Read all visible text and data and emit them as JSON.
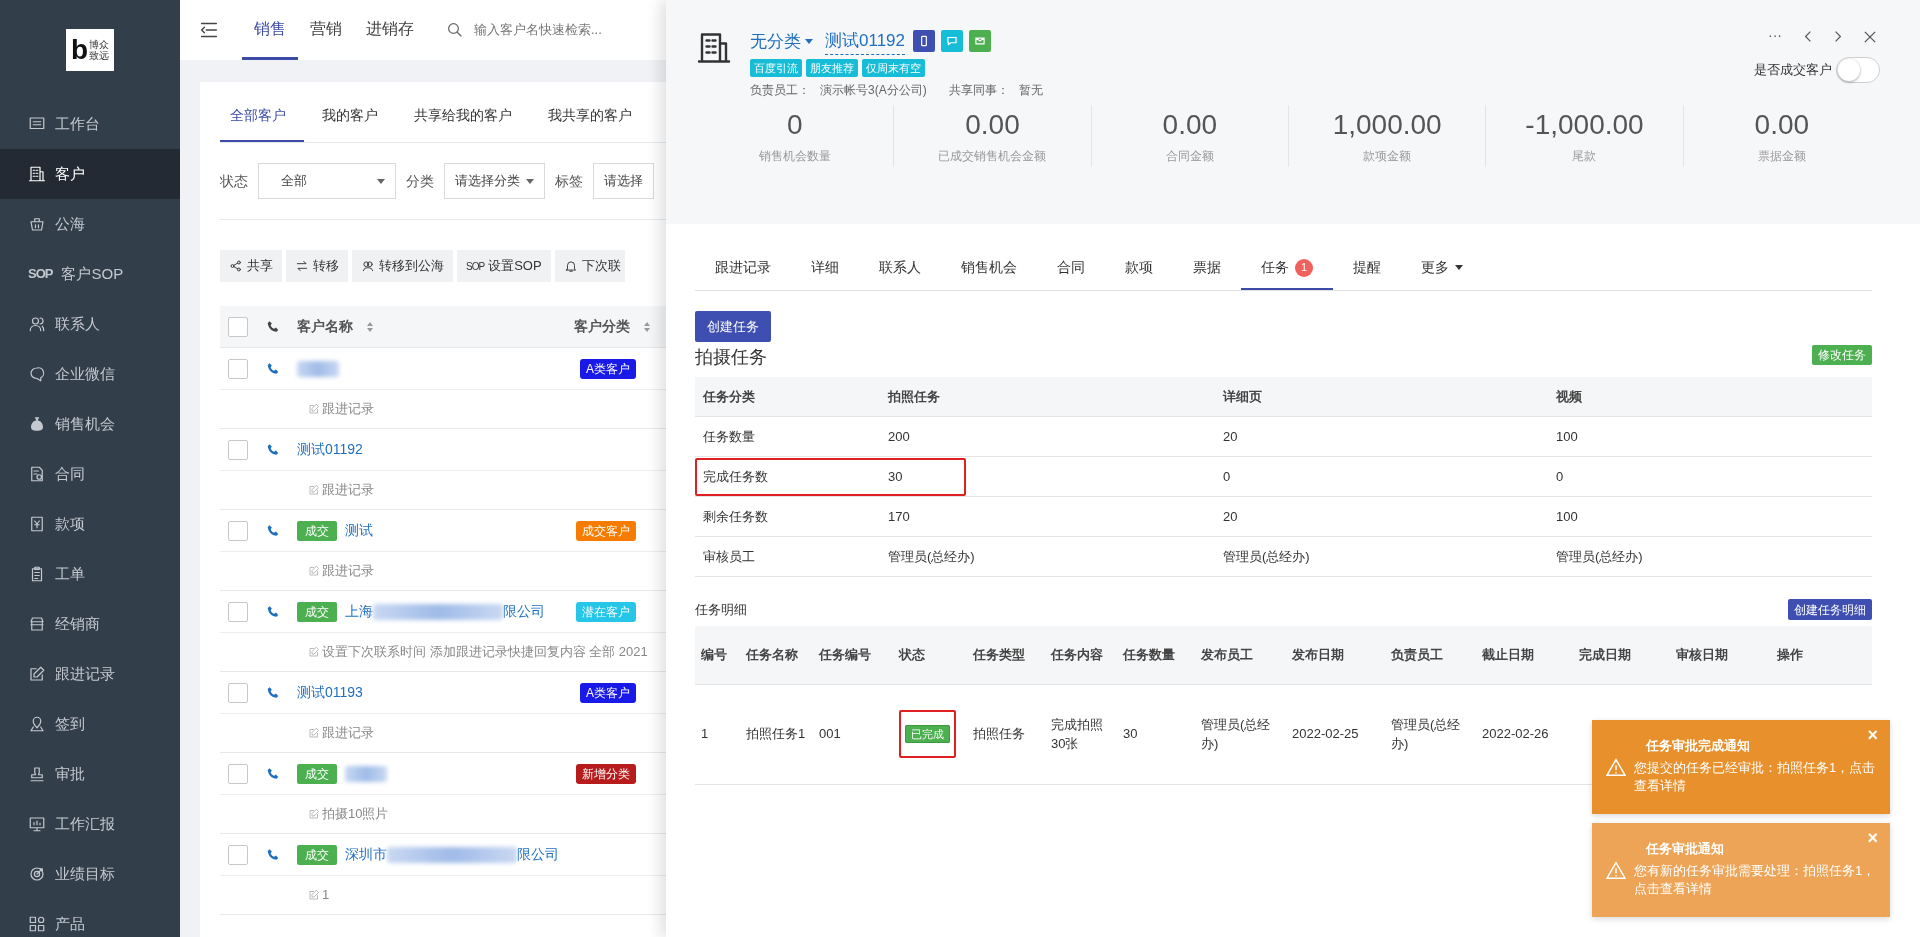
{
  "sidebar": {
    "logo": {
      "letter": "b",
      "text": [
        "博众",
        "致远"
      ]
    },
    "items": [
      {
        "label": "工作台",
        "selected": false
      },
      {
        "label": "客户",
        "selected": true
      },
      {
        "label": "公海",
        "selected": false
      },
      {
        "label": "客户SOP",
        "icon_text": "SOP",
        "selected": false
      },
      {
        "label": "联系人",
        "selected": false
      },
      {
        "label": "企业微信",
        "selected": false
      },
      {
        "label": "销售机会",
        "selected": false
      },
      {
        "label": "合同",
        "selected": false
      },
      {
        "label": "款项",
        "selected": false
      },
      {
        "label": "工单",
        "selected": false
      },
      {
        "label": "经销商",
        "selected": false
      },
      {
        "label": "跟进记录",
        "selected": false
      },
      {
        "label": "签到",
        "selected": false
      },
      {
        "label": "审批",
        "selected": false
      },
      {
        "label": "工作汇报",
        "selected": false
      },
      {
        "label": "业绩目标",
        "selected": false
      },
      {
        "label": "产品",
        "selected": false
      }
    ]
  },
  "top_nav": {
    "tabs": [
      {
        "label": "销售",
        "selected": true
      },
      {
        "label": "营销",
        "selected": false
      },
      {
        "label": "进销存",
        "selected": false
      }
    ],
    "search": {
      "placeholder": "输入客户名快速检索..."
    }
  },
  "customer_list": {
    "tabs": [
      {
        "label": "全部客户",
        "selected": true
      },
      {
        "label": "我的客户",
        "selected": false
      },
      {
        "label": "共享给我的客户",
        "selected": false
      },
      {
        "label": "我共享的客户",
        "selected": false
      }
    ],
    "filters": [
      {
        "label": "状态",
        "value": "全部"
      },
      {
        "label": "分类",
        "value": "请选择分类"
      },
      {
        "label": "标签",
        "value": "请选择"
      }
    ],
    "actions": [
      {
        "label": "共享"
      },
      {
        "label": "转移"
      },
      {
        "label": "转移到公海"
      },
      {
        "label": "设置SOP",
        "icon_text": "SOP"
      },
      {
        "label": "下次联"
      }
    ],
    "select_all_checked": false,
    "columns": [
      "客户名称",
      "客户分类"
    ],
    "rows": [
      {
        "checked": false,
        "redacted": true,
        "category": {
          "label": "A类客户",
          "color": "#1a1ae8"
        },
        "note": "跟进记录"
      },
      {
        "checked": false,
        "name": "测试01192",
        "redacted": false,
        "note": "跟进记录"
      },
      {
        "checked": false,
        "deal_tag": "成交",
        "name": "测试",
        "redacted": false,
        "category": {
          "label": "成交客户",
          "color": "#f57c00"
        },
        "note": "跟进记录"
      },
      {
        "checked": false,
        "deal_tag": "成交",
        "name": "上海",
        "redacted": true,
        "name_suffix": "限公司",
        "category": {
          "label": "潜在客户",
          "color": "#26c6e8"
        },
        "note": "设置下次联系时间 添加跟进记录快捷回复内容 全部 2021"
      },
      {
        "checked": false,
        "name": "测试01193",
        "redacted": false,
        "category": {
          "label": "A类客户",
          "color": "#1a1ae8"
        },
        "note": "跟进记录"
      },
      {
        "checked": false,
        "deal_tag": "成交",
        "redacted": true,
        "category": {
          "label": "新增分类",
          "color": "#b71c1c"
        },
        "note": "拍摄10照片"
      },
      {
        "checked": false,
        "deal_tag": "成交",
        "name": "深圳市",
        "redacted": true,
        "name_suffix": "限公司",
        "note": "1"
      }
    ]
  },
  "drawer": {
    "category": "无分类",
    "name": "测试01192",
    "tags": [
      "百度引流",
      "朋友推荐",
      "仅周末有空"
    ],
    "owner_label": "负责员工：",
    "owner": "演示帐号3(A分公司)",
    "shared_label": "共享同事：",
    "shared": "暂无",
    "more": "···",
    "deal_toggle": {
      "label": "是否成交客户",
      "on": false
    },
    "stats": [
      {
        "value": "0",
        "label": "销售机会数量"
      },
      {
        "value": "0.00",
        "label": "已成交销售机会金额"
      },
      {
        "value": "0.00",
        "label": "合同金额"
      },
      {
        "value": "1,000.00",
        "label": "款项金额"
      },
      {
        "value": "-1,000.00",
        "label": "尾款"
      },
      {
        "value": "0.00",
        "label": "票据金额"
      }
    ],
    "tabs": [
      {
        "label": "跟进记录",
        "selected": false
      },
      {
        "label": "详细",
        "selected": false
      },
      {
        "label": "联系人",
        "selected": false
      },
      {
        "label": "销售机会",
        "selected": false
      },
      {
        "label": "合同",
        "selected": false
      },
      {
        "label": "款项",
        "selected": false
      },
      {
        "label": "票据",
        "selected": false
      },
      {
        "label": "任务",
        "selected": true,
        "badge": "1"
      },
      {
        "label": "提醒",
        "selected": false
      },
      {
        "label": "更多",
        "selected": false,
        "dropdown": true
      }
    ],
    "task_panel": {
      "create_button": "创建任务",
      "title": "拍摄任务",
      "edit_button": "修改任务",
      "summary": {
        "columns": [
          "任务分类",
          "拍照任务",
          "详细页",
          "视频"
        ],
        "rows": [
          {
            "cells": [
              "任务数量",
              "200",
              "20",
              "100"
            ],
            "highlighted": false
          },
          {
            "cells": [
              "完成任务数",
              "30",
              "0",
              "0"
            ],
            "highlighted": true
          },
          {
            "cells": [
              "剩余任务数",
              "170",
              "20",
              "100"
            ],
            "highlighted": false
          },
          {
            "cells": [
              "审核员工",
              "管理员(总经办)",
              "管理员(总经办)",
              "管理员(总经办)"
            ],
            "highlighted": false
          }
        ]
      },
      "detail_title": "任务明细",
      "detail_button": "创建任务明细",
      "detail": {
        "columns": [
          "编号",
          "任务名称",
          "任务编号",
          "状态",
          "任务类型",
          "任务内容",
          "任务数量",
          "发布员工",
          "发布日期",
          "负责员工",
          "截止日期",
          "完成日期",
          "审核日期",
          "操作"
        ],
        "rows": [
          {
            "cells": [
              {
                "kind": "text",
                "text": "1"
              },
              {
                "kind": "text",
                "text": "拍照任务1"
              },
              {
                "kind": "text",
                "text": "001"
              },
              {
                "kind": "status",
                "text": "已完成",
                "highlighted": true
              },
              {
                "kind": "text",
                "text": "拍照任务"
              },
              {
                "kind": "text",
                "text": "完成拍照30张"
              },
              {
                "kind": "text",
                "text": "30"
              },
              {
                "kind": "text",
                "text": "管理员(总经办)"
              },
              {
                "kind": "text",
                "text": "2022-02-25"
              },
              {
                "kind": "text",
                "text": "管理员(总经办)"
              },
              {
                "kind": "text",
                "text": "2022-02-26"
              }
            ]
          }
        ]
      }
    }
  },
  "notifications": [
    {
      "title": "任务审批完成通知",
      "message": "您提交的任务已经审批：拍照任务1，点击查看详情",
      "close": "×",
      "color": "#e8912c"
    },
    {
      "title": "任务审批通知",
      "message": "您有新的任务审批需要处理：拍照任务1，点击查看详情",
      "close": "×",
      "color": "#eda456"
    }
  ]
}
